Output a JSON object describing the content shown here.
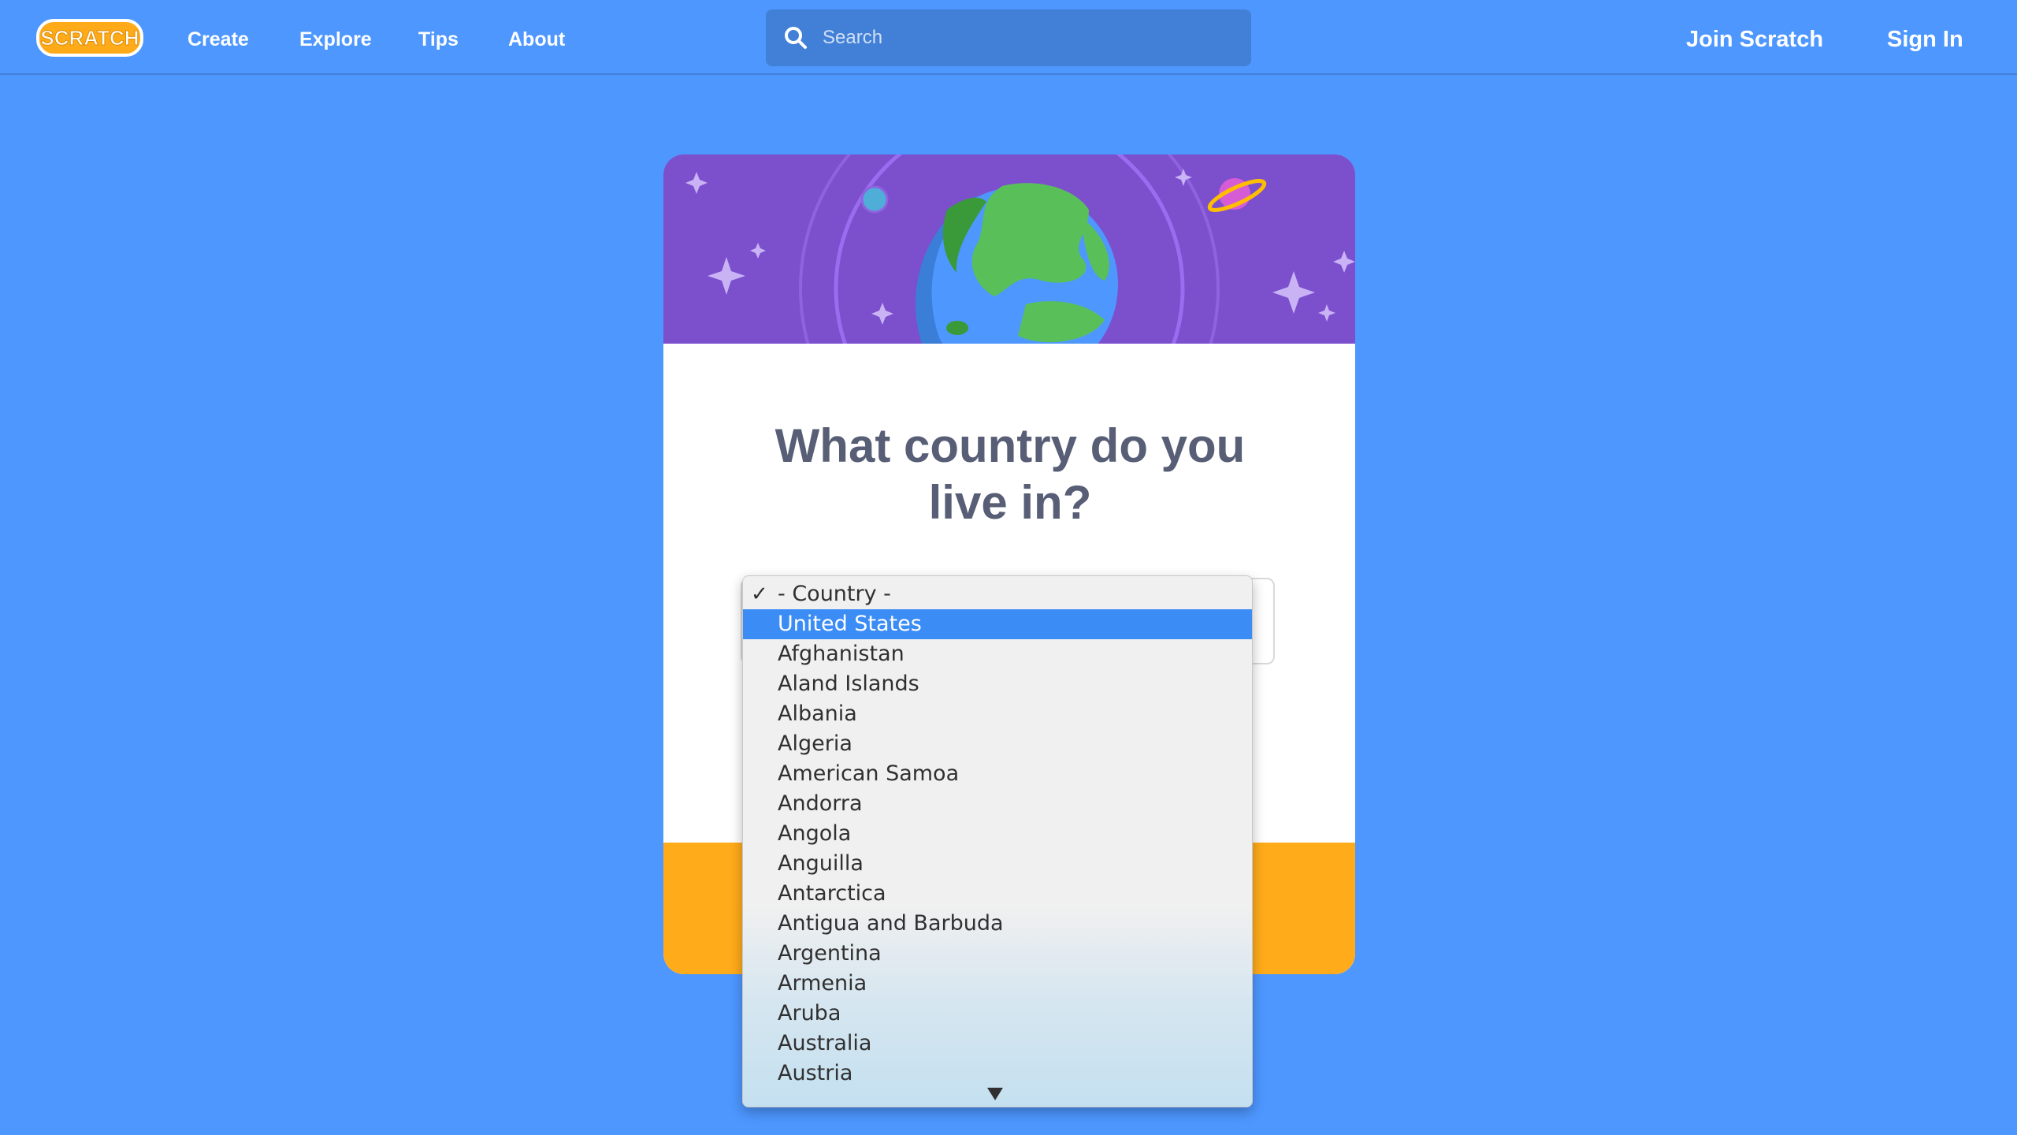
{
  "navbar": {
    "logo_text": "SCRATCH",
    "links": [
      "Create",
      "Explore",
      "Tips",
      "About"
    ],
    "search_placeholder": "Search",
    "join_label": "Join Scratch",
    "signin_label": "Sign In"
  },
  "card": {
    "question": "What country do you live in?"
  },
  "dropdown": {
    "header": "- Country -",
    "checkmark": "✓",
    "selected": "United States",
    "options": [
      "Afghanistan",
      "Aland Islands",
      "Albania",
      "Algeria",
      "American Samoa",
      "Andorra",
      "Angola",
      "Anguilla",
      "Antarctica",
      "Antigua and Barbuda",
      "Argentina",
      "Armenia",
      "Aruba",
      "Australia",
      "Austria"
    ]
  },
  "colors": {
    "page_bg": "#4d97ff",
    "banner": "#7c4fcd",
    "footer": "#ffab1a",
    "highlight": "#3b8cf5",
    "question_text": "#575e75"
  }
}
